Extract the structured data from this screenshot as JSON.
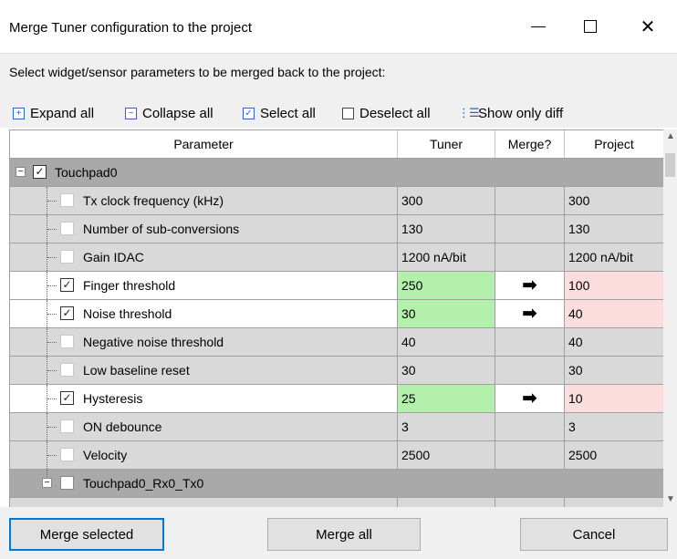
{
  "window": {
    "title": "Merge Tuner configuration to the project",
    "minimize_icon": "minimize-icon",
    "maximize_icon": "maximize-icon",
    "close_icon": "close-icon",
    "close_glyph": "✕"
  },
  "instruction": "Select widget/sensor parameters to be merged back to the project:",
  "toolbar": {
    "expand_all": "Expand all",
    "collapse_all": "Collapse all",
    "select_all": "Select all",
    "deselect_all": "Deselect all",
    "show_only_diff": "Show only diff"
  },
  "columns": {
    "parameter": "Parameter",
    "tuner": "Tuner",
    "merge": "Merge?",
    "project": "Project"
  },
  "tree": {
    "group_touchpad0": "Touchpad0",
    "group_rx0tx0": "Touchpad0_Rx0_Tx0",
    "toggle_glyph": "−",
    "check_glyph": "✓",
    "arrow_glyph": "➡"
  },
  "rows": [
    {
      "parameter": "Tx clock frequency (kHz)",
      "tuner": "300",
      "project": "300",
      "checked": false,
      "diff": false
    },
    {
      "parameter": "Number of sub-conversions",
      "tuner": "130",
      "project": "130",
      "checked": false,
      "diff": false
    },
    {
      "parameter": "Gain IDAC",
      "tuner": "1200 nA/bit",
      "project": "1200 nA/bit",
      "checked": false,
      "diff": false
    },
    {
      "parameter": "Finger threshold",
      "tuner": "250",
      "project": "100",
      "checked": true,
      "diff": true
    },
    {
      "parameter": "Noise threshold",
      "tuner": "30",
      "project": "40",
      "checked": true,
      "diff": true
    },
    {
      "parameter": "Negative noise threshold",
      "tuner": "40",
      "project": "40",
      "checked": false,
      "diff": false
    },
    {
      "parameter": "Low baseline reset",
      "tuner": "30",
      "project": "30",
      "checked": false,
      "diff": false
    },
    {
      "parameter": "Hysteresis",
      "tuner": "25",
      "project": "10",
      "checked": true,
      "diff": true
    },
    {
      "parameter": "ON debounce",
      "tuner": "3",
      "project": "3",
      "checked": false,
      "diff": false
    },
    {
      "parameter": "Velocity",
      "tuner": "2500",
      "project": "2500",
      "checked": false,
      "diff": false
    }
  ],
  "buttons": {
    "merge_selected": "Merge selected",
    "merge_all": "Merge all",
    "cancel": "Cancel"
  },
  "colors": {
    "tuner_diff": "#b3f0ac",
    "project_diff": "#fcdddd",
    "group_row": "#a9a9a9",
    "normal_row": "#d9d9d9",
    "accent": "#0078d7"
  }
}
